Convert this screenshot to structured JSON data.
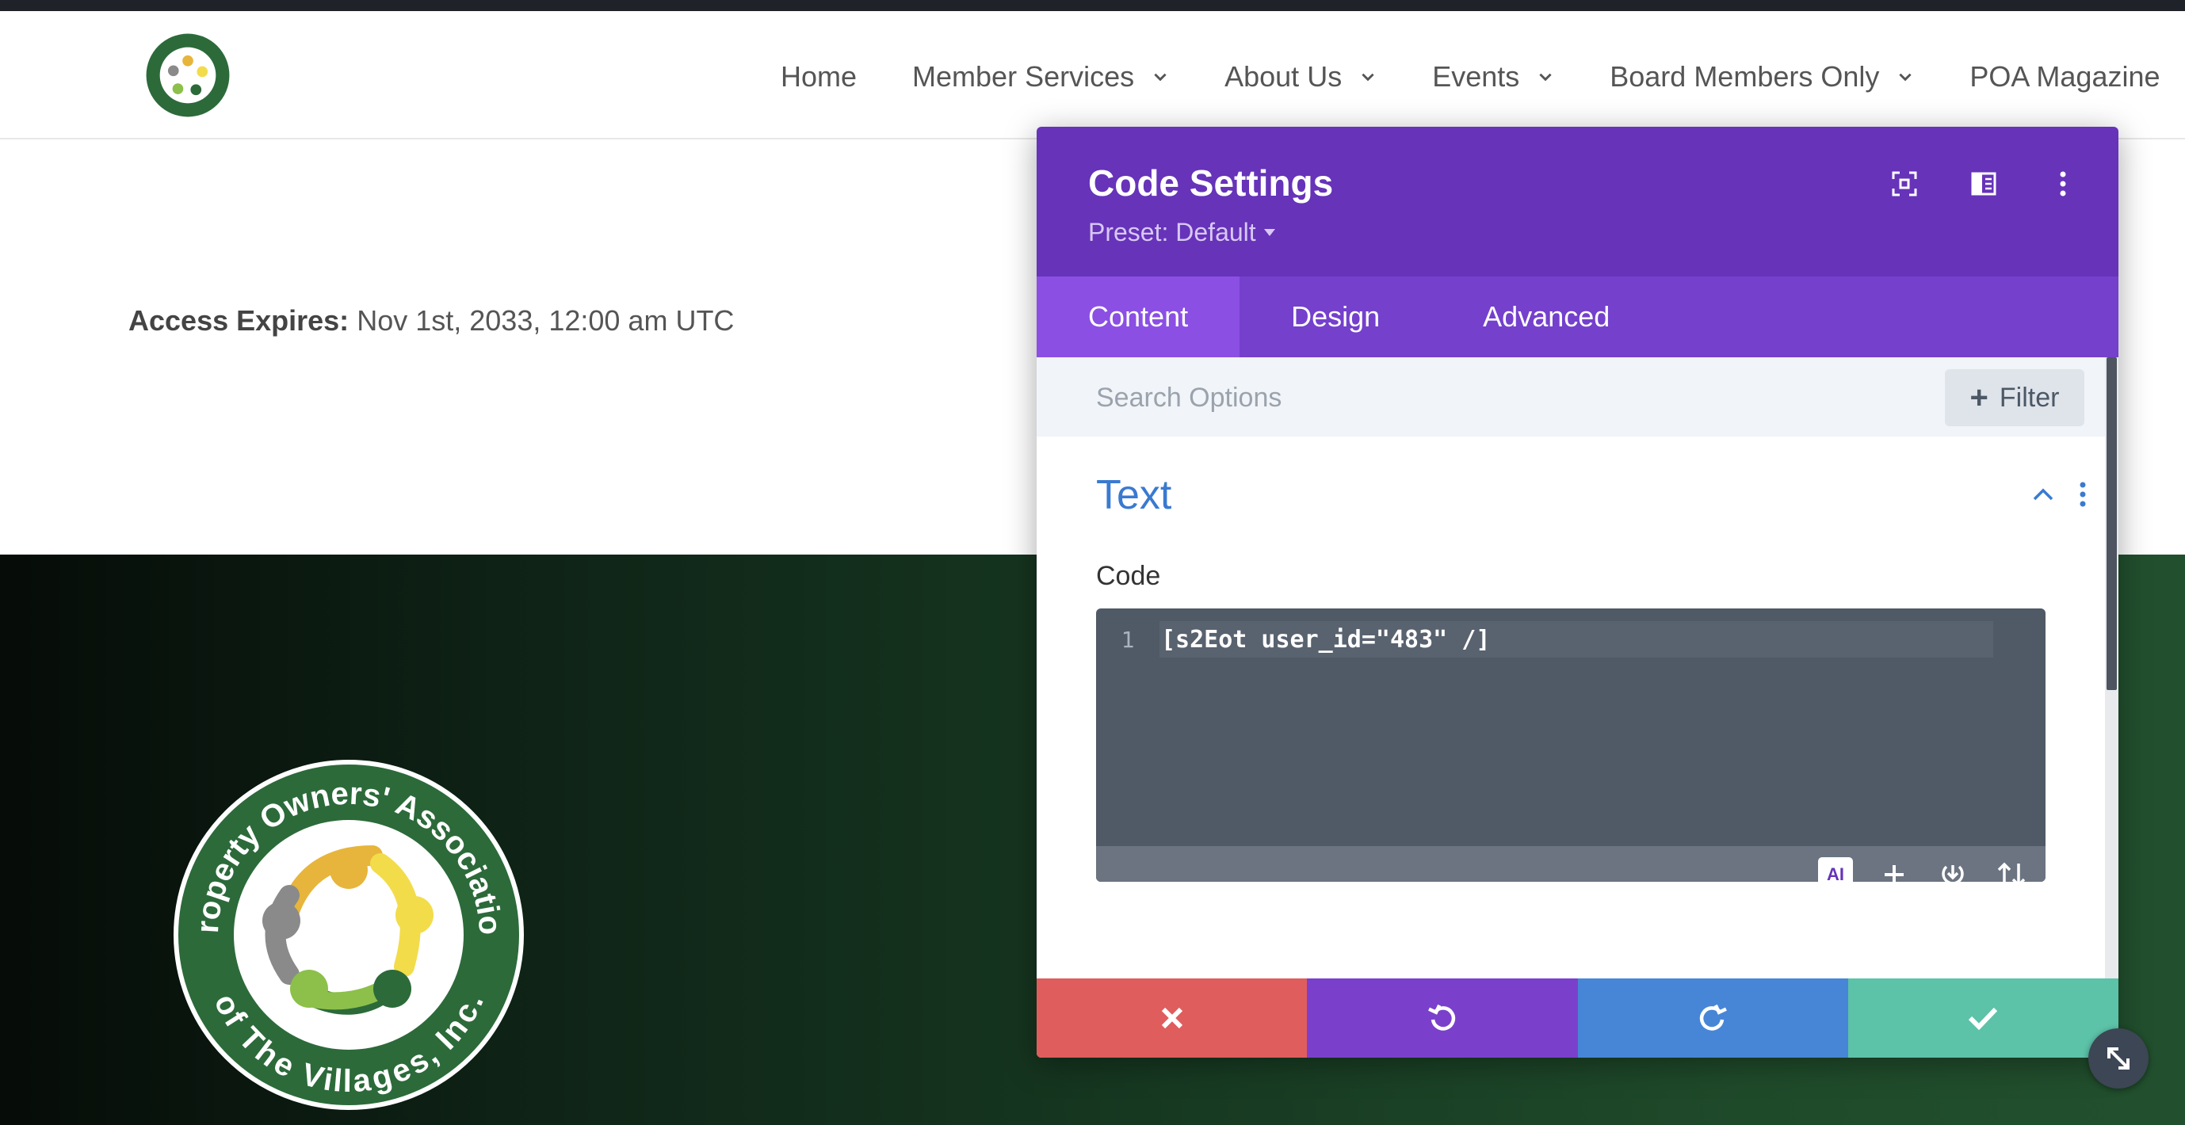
{
  "header": {
    "nav": [
      {
        "label": "Home",
        "has_dropdown": false
      },
      {
        "label": "Member Services",
        "has_dropdown": true
      },
      {
        "label": "About Us",
        "has_dropdown": true
      },
      {
        "label": "Events",
        "has_dropdown": true
      },
      {
        "label": "Board Members Only",
        "has_dropdown": true
      },
      {
        "label": "POA Magazine",
        "has_dropdown": false
      }
    ]
  },
  "logo": {
    "top_text": "Property Owners' Association",
    "bottom_text": "of The Villages, Inc."
  },
  "main": {
    "access_label": "Access Expires:",
    "access_value": "Nov 1st, 2033, 12:00 am UTC"
  },
  "panel": {
    "title": "Code Settings",
    "preset": "Preset: Default",
    "tabs": [
      {
        "label": "Content",
        "active": true
      },
      {
        "label": "Design",
        "active": false
      },
      {
        "label": "Advanced",
        "active": false
      }
    ],
    "search_placeholder": "Search Options",
    "filter_label": "Filter",
    "section_title": "Text",
    "code_label": "Code",
    "code_lines": [
      {
        "number": "1",
        "text": "[s2Eot user_id=\"483\" /]"
      }
    ],
    "ai_label": "AI",
    "colors": {
      "header": "#6633b9",
      "tabs": "#7440cc",
      "tab_active": "#8b4fe4",
      "discard": "#e05d5d",
      "undo": "#7a40cc",
      "redo": "#4786d6",
      "save": "#5cc2a8",
      "section_title": "#3a7ad0"
    },
    "icons": [
      "fullscreen-icon",
      "split-view-icon",
      "more-vertical-icon",
      "chevron-up-icon",
      "plus-icon",
      "download-icon",
      "sort-icon",
      "close-icon",
      "undo-icon",
      "redo-icon",
      "check-icon",
      "resize-icon"
    ]
  }
}
